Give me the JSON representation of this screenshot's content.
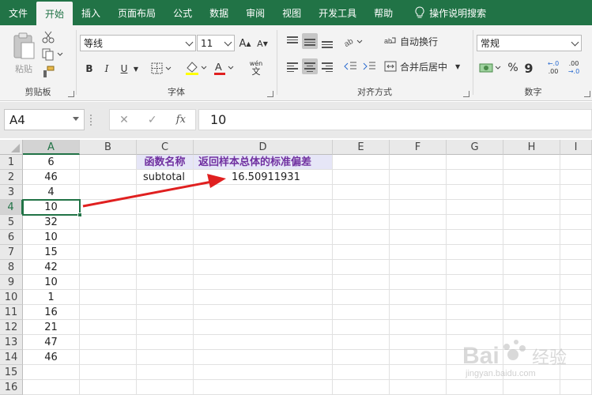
{
  "tabs": [
    "文件",
    "开始",
    "插入",
    "页面布局",
    "公式",
    "数据",
    "审阅",
    "视图",
    "开发工具",
    "帮助"
  ],
  "tell_me": "操作说明搜索",
  "ribbon": {
    "clipboard": {
      "label": "剪贴板",
      "paste": "粘贴"
    },
    "font": {
      "label": "字体",
      "name": "等线",
      "size": "11",
      "bold": "B",
      "italic": "I",
      "underline": "U",
      "grow": "A",
      "shrink": "A",
      "phonetic_top": "wén",
      "phonetic_bottom": "文"
    },
    "alignment": {
      "label": "对齐方式",
      "wrap": "自动换行",
      "merge": "合并后居中"
    },
    "number": {
      "label": "数字",
      "format": "常规",
      "percent": "%",
      "comma": "9",
      "inc_dec": ".00",
      "dec_dec": ".00"
    }
  },
  "formula_bar": {
    "name_box": "A4",
    "cancel": "✕",
    "enter": "✓",
    "fx": "fx",
    "content": "10"
  },
  "columns": [
    "A",
    "B",
    "C",
    "D",
    "E",
    "F",
    "G",
    "H",
    "I"
  ],
  "rows": [
    "1",
    "2",
    "3",
    "4",
    "5",
    "6",
    "7",
    "8",
    "9",
    "10",
    "11",
    "12",
    "13",
    "14",
    "15",
    "16"
  ],
  "column_a": [
    "6",
    "46",
    "4",
    "10",
    "32",
    "10",
    "15",
    "42",
    "10",
    "1",
    "16",
    "21",
    "47",
    "46"
  ],
  "cells": {
    "c1": "函数名称",
    "d1": "返回样本总体的标准偏差",
    "c2": "subtotal",
    "d2": "16.50911931"
  },
  "watermark": {
    "brand": "Bai",
    "brand2": "经验",
    "url": "jingyan.baidu.com"
  },
  "colors": {
    "accent": "#217346",
    "header_fill": "#e6e6f7",
    "header_text": "#7030a0",
    "arrow": "#e02020"
  }
}
